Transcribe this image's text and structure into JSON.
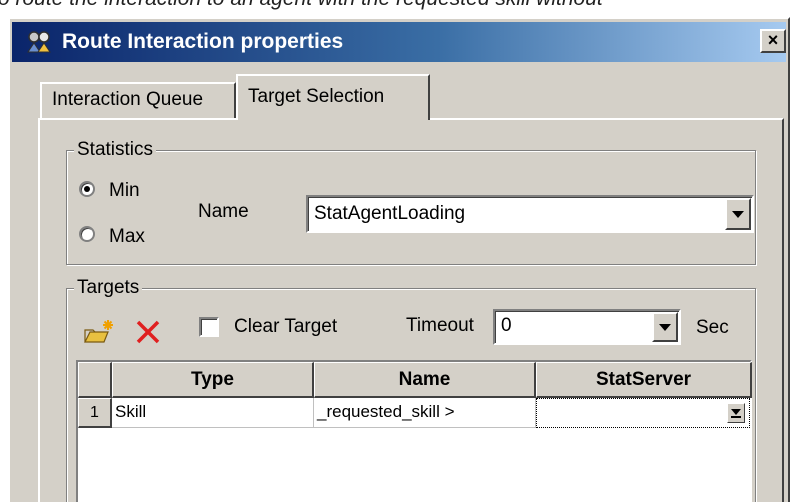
{
  "caption": "o route the interaction to an agent with the requested skill without",
  "window": {
    "title": "Route Interaction properties",
    "close_label": "×"
  },
  "tabs": [
    {
      "label": "Interaction Queue",
      "active": false
    },
    {
      "label": "Target Selection",
      "active": true
    }
  ],
  "statistics": {
    "legend": "Statistics",
    "min_label": "Min",
    "max_label": "Max",
    "selected": "Min",
    "name_label": "Name",
    "name_value": "StatAgentLoading"
  },
  "targets": {
    "legend": "Targets",
    "clear_target_label": "Clear Target",
    "clear_target_checked": false,
    "timeout_label": "Timeout",
    "timeout_value": "0",
    "sec_label": "Sec",
    "columns": [
      "Type",
      "Name",
      "StatServer"
    ],
    "rows": [
      {
        "num": "1",
        "type": "Skill",
        "name": "_requested_skill >",
        "statserver": ""
      }
    ]
  },
  "icons": {
    "title": "route-robot-icon",
    "add": "add-target-icon",
    "delete": "delete-x-icon",
    "dropdown": "chevron-down-icon"
  },
  "colors": {
    "title_gradient_start": "#0a246a",
    "title_gradient_end": "#a6caf0",
    "face": "#d4d0c8",
    "delete_icon": "#e02020"
  }
}
